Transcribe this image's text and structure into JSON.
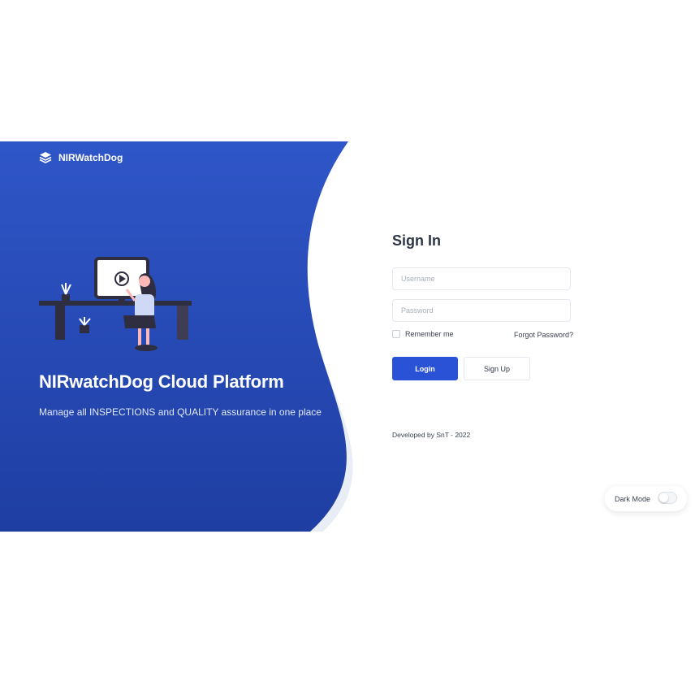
{
  "brand": {
    "name": "NIRWatchDog",
    "logo_icon": "layers-icon"
  },
  "hero": {
    "title": "NIRwatchDog Cloud Platform",
    "subtitle": "Manage all INSPECTIONS and QUALITY assurance in one place",
    "color_top": "#2f56c8",
    "color_bottom": "#1e3ea2"
  },
  "signin": {
    "title": "Sign In",
    "username_placeholder": "Username",
    "password_placeholder": "Password",
    "remember_label": "Remember me",
    "forgot_label": "Forgot Password?",
    "login_label": "Login",
    "signup_label": "Sign Up",
    "credit": "Developed by SnT - 2022"
  },
  "dark_mode": {
    "label": "Dark Mode",
    "enabled": false
  },
  "colors": {
    "accent": "#2a52d6"
  }
}
